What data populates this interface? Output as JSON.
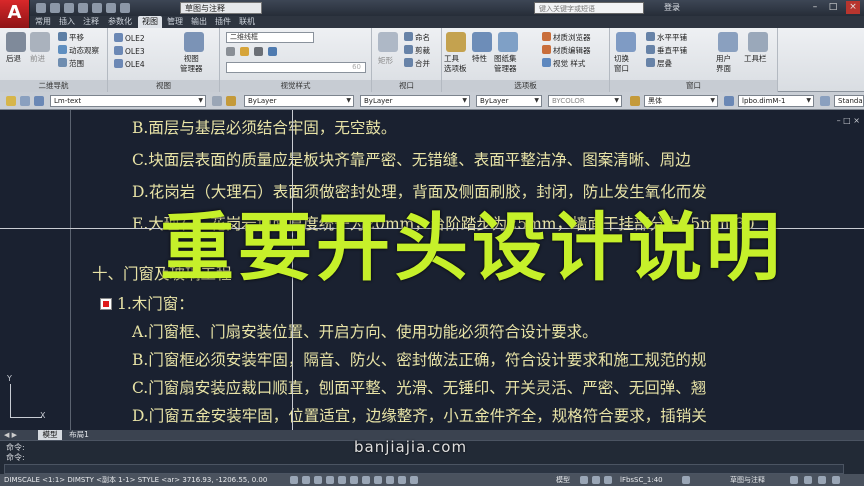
{
  "titlebar": {
    "logo_letter": "A",
    "workspace": "草图与注释",
    "search_placeholder": "键入关键字或短语",
    "login": "登录",
    "minimize": "–",
    "maximize": "□",
    "close": "×"
  },
  "tabs": [
    "常用",
    "插入",
    "注释",
    "参数化",
    "视图",
    "管理",
    "输出",
    "插件",
    "联机"
  ],
  "active_tab": "视图",
  "ribbon": {
    "nav2d": {
      "title": "二维导航",
      "back": "后退",
      "forward": "前进",
      "pan": "平移",
      "dynamic_observe": "动态观察",
      "range": "范围"
    },
    "view_panel": {
      "title": "视图",
      "views": [
        "OLE2",
        "OLE3",
        "OLE4"
      ],
      "view_manager": "视图\n管理器"
    },
    "visual_styles": {
      "title": "视觉样式",
      "style": "二维线框",
      "opacity_value": "60"
    },
    "model_viewports": {
      "title": "视口",
      "named": "命名",
      "clip": "剪裁",
      "merge": "合并",
      "rect": "矩形"
    },
    "palettes": {
      "title": "选项板",
      "tool_palettes": "工具\n选项板",
      "properties": "特性",
      "sheetset": "图纸集\n管理器",
      "material_browser": "材质浏览器",
      "material_editor": "材质编辑器",
      "visual_styles": "视觉 样式"
    },
    "window_panel": {
      "title": "窗口",
      "switch_windows": "切换\n窗口",
      "tile_h": "水平平铺",
      "tile_v": "垂直平铺",
      "cascade": "层叠",
      "user_interface": "用户\n界面",
      "toolbars": "工具栏"
    }
  },
  "properties_bar": {
    "layer": "Lm-text",
    "color": "ByLayer",
    "linetype": "ByLayer",
    "lineweight": "ByLayer",
    "plotstyle": "BYCOLOR",
    "text_font": "黑体",
    "dim_style": "lpbo.dimM-1",
    "table_style": "Standard"
  },
  "drawing": {
    "lines": [
      "B.面层与基层必须结合牢固，无空鼓。",
      "C.块面层表面的质量应是板块齐靠严密、无错缝、表面平整洁净、图案清晰、周边",
      "D.花岗岩（大理石）表面须做密封处理，背面及侧面刷胶，封闭，防止发生氧化而发",
      "E.大理石、花岗岩地面厚度统一为20mm，台阶踏步为25mm，墙面干挂部分为25mm-30",
      "十、门窗及玻璃工程",
      "1.木门窗：",
      "A.门窗框、门扇安装位置、开启方向、使用功能必须符合设计要求。",
      "B.门窗框必须安装牢固，隔音、防火、密封做法正确，符合设计要求和施工规范的规",
      "C.门窗扇安装应裁口顺直，刨面平整、光滑、无锤印、开关灵活、严密、无回弹、翘",
      "D.门窗五金安装牢固，位置适宜，边缘整齐，小五金件齐全，规格符合要求，插销关"
    ],
    "overlay_title": "重要开头设计说明",
    "viewport_controls": "– □ ×",
    "ucs_y": "Y",
    "ucs_x": "X",
    "watermark": "banjiajia.com"
  },
  "layout_tabs": [
    "模型",
    "布局1"
  ],
  "active_layout": "模型",
  "command": {
    "history_1": "命令:",
    "history_2": "命令:",
    "prompt": ""
  },
  "statusbar": {
    "left_text": "DIMSCALE <1:1> DIMSTY <副本 1-1> STYLE <ar>  3716.93, -1206.55, 0.00",
    "model": "模型",
    "scale": "lFbsSC_1:40",
    "workspace": "草图与注释"
  },
  "colors": {
    "drawing_bg": "#1a2130",
    "text_yellow": "#e8e3a6",
    "overlay_green": "#c6f02a",
    "marker_red": "#e01b1b"
  }
}
